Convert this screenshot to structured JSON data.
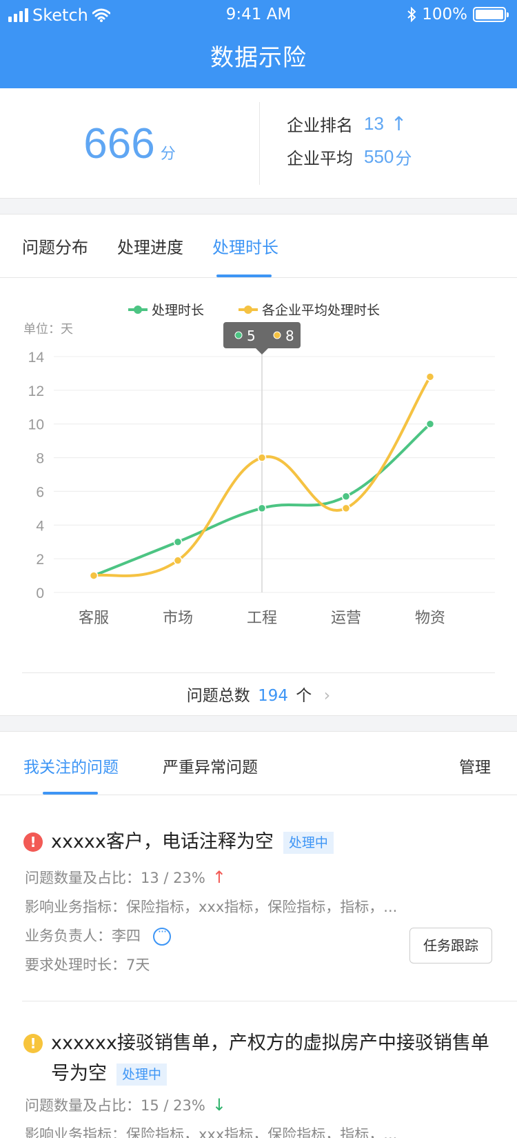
{
  "status_bar": {
    "carrier": "Sketch",
    "time": "9:41 AM",
    "battery": "100%"
  },
  "nav": {
    "title": "数据示险"
  },
  "score": {
    "value": "666",
    "unit": "分",
    "rank_label": "企业排名",
    "rank_value": "13",
    "rank_arrow": "↑",
    "avg_label": "企业平均",
    "avg_value": "550",
    "avg_unit": "分"
  },
  "tabs": [
    {
      "label": "问题分布"
    },
    {
      "label": "处理进度"
    },
    {
      "label": "处理时长"
    }
  ],
  "chart_data": {
    "type": "line",
    "categories": [
      "客服",
      "市场",
      "工程",
      "运营",
      "物资"
    ],
    "series": [
      {
        "name": "处理时长",
        "values": [
          1,
          3,
          5,
          5.7,
          10
        ],
        "color": "#4cc483"
      },
      {
        "name": "各企业平均处理时长",
        "values": [
          1,
          1.9,
          8,
          5,
          12.8
        ],
        "color": "#f5c242"
      }
    ],
    "unit_label": "单位：天",
    "ylim": [
      0,
      14
    ],
    "yticks": [
      "0",
      "2",
      "4",
      "6",
      "8",
      "10",
      "12",
      "14"
    ],
    "grid": true,
    "legend_position": "top",
    "tooltip": {
      "category_index": 2,
      "values": [
        "5",
        "8"
      ]
    }
  },
  "total": {
    "label": "问题总数",
    "value": "194",
    "unit": "个"
  },
  "issue_tabs": {
    "items": [
      {
        "label": "我关注的问题"
      },
      {
        "label": "严重异常问题"
      }
    ],
    "manage": "管理"
  },
  "issues": [
    {
      "title": "xxxxx客户，电话注释为空",
      "status": "处理中",
      "severity_color": "#f25a55",
      "count_text": "问题数量及占比：13 / 23%",
      "trend": "↑",
      "impact": "影响业务指标：保险指标，xxx指标，保险指标，指标，...",
      "owner": "业务负责人：李四",
      "duration": "要求处理时长：7天",
      "button": "任务跟踪"
    },
    {
      "title": "xxxxxx接驳销售单，产权方的虚拟房产中接驳销售单号为空",
      "status": "处理中",
      "severity_color": "#f7c43c",
      "count_text": "问题数量及占比：15 / 23%",
      "trend": "↓",
      "impact": "影响业务指标：保险指标，xxx指标，保险指标，指标，..."
    }
  ]
}
